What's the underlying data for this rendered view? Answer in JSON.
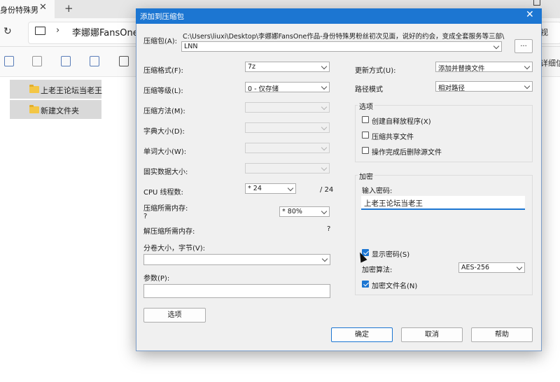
{
  "background": {
    "tab_title": "身份特殊男",
    "tab_close": "✕",
    "tab_add": "+",
    "refresh_icon": "↻",
    "chevron": "›",
    "address_path": "李娜娜FansOne作",
    "address_right": "视",
    "toolbar_right": "详细信",
    "files": [
      "上老王论坛当老王",
      "新建文件夹"
    ],
    "window_min": "—"
  },
  "dialog": {
    "title": "添加到压缩包",
    "close_icon": "✕",
    "archive": {
      "label": "压缩包(A):",
      "path": "C:\\Users\\liuxi\\Desktop\\李娜娜FansOne作品-身份特殊男粉丝初次见面，说好的约会，变成全套服务等三部\\",
      "name": "LNN",
      "browse_label": "..."
    },
    "left": {
      "format_label": "压缩格式(F):",
      "format_value": "7z",
      "level_label": "压缩等级(L):",
      "level_value": "0 - 仅存储",
      "method_label": "压缩方法(M):",
      "dict_label": "字典大小(D):",
      "word_label": "单词大小(W):",
      "solid_label": "固实数据大小:",
      "cpu_label": "CPU 线程数:",
      "cpu_value": "* 24",
      "cpu_total": "/ 24",
      "mem_label": "压缩所需内存:",
      "mem_q": "?",
      "mem_value": "* 80%",
      "decomp_label": "解压缩所需内存:",
      "decomp_q": "?",
      "split_label": "分卷大小，字节(V):",
      "params_label": "参数(P):",
      "options_button": "选项"
    },
    "right": {
      "update_label": "更新方式(U):",
      "update_value": "添加并替换文件",
      "pathmode_label": "路径模式",
      "pathmode_value": "相对路径",
      "options_group": "选项",
      "opt_sfx": "创建自释放程序(X)",
      "opt_shared": "压缩共享文件",
      "opt_delete": "操作完成后删除源文件",
      "encrypt_group": "加密",
      "password_label": "输入密码:",
      "password_value": "上老王论坛当老王",
      "show_password": "显示密码(S)",
      "enc_method_label": "加密算法:",
      "enc_method_value": "AES-256",
      "enc_names": "加密文件名(N)"
    },
    "buttons": {
      "ok": "确定",
      "cancel": "取消",
      "help": "帮助"
    }
  }
}
